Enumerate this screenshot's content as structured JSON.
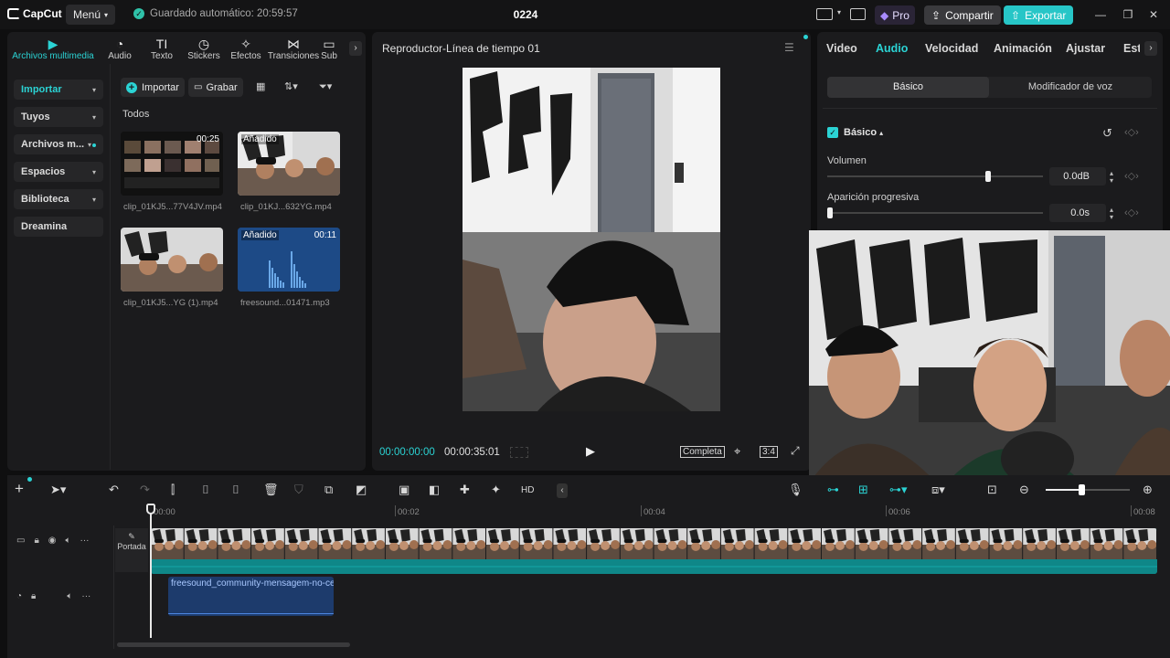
{
  "app": {
    "name": "CapCut",
    "menu_label": "Menú",
    "autosave": "Guardado automático: 20:59:57",
    "project_title": "0224",
    "pro_label": "Pro",
    "share_label": "Compartir",
    "export_label": "Exportar",
    "accent": "#2bd3d4"
  },
  "media": {
    "tabs": [
      {
        "label": "Archivos multimedia",
        "icon": "media-icon"
      },
      {
        "label": "Audio",
        "icon": "audio-icon"
      },
      {
        "label": "Texto",
        "icon": "text-icon"
      },
      {
        "label": "Stickers",
        "icon": "sticker-icon"
      },
      {
        "label": "Efectos",
        "icon": "effects-icon"
      },
      {
        "label": "Transiciones",
        "icon": "transition-icon"
      },
      {
        "label": "Sub",
        "icon": "subtitle-icon"
      }
    ],
    "sidebar": [
      {
        "label": "Importar"
      },
      {
        "label": "Tuyos"
      },
      {
        "label": "Archivos m..."
      },
      {
        "label": "Espacios"
      },
      {
        "label": "Biblioteca"
      },
      {
        "label": "Dreamina"
      }
    ],
    "import_label": "Importar",
    "record_label": "Grabar",
    "section_label": "Todos",
    "items": [
      {
        "name": "clip_01KJ5...77V4JV.mp4",
        "duration": "00:25",
        "tag": ""
      },
      {
        "name": "clip_01KJ...632YG.mp4",
        "duration": "",
        "tag": "Añadido"
      },
      {
        "name": "clip_01KJ5...YG (1).mp4",
        "duration": "",
        "tag": ""
      },
      {
        "name": "freesound...01471.mp3",
        "duration": "00:11",
        "tag": "Añadido"
      }
    ]
  },
  "player": {
    "title": "Reproductor-Línea de tiempo 01",
    "current_time": "00:00:00:00",
    "total_time": "00:00:35:01",
    "full_label": "Completa",
    "ratio_label": "3:4"
  },
  "inspector": {
    "tabs": [
      "Video",
      "Audio",
      "Velocidad",
      "Animación",
      "Ajustar",
      "Est"
    ],
    "active_tab": "Audio",
    "segments": [
      "Básico",
      "Modificador de voz"
    ],
    "section_title": "Básico",
    "volume_label": "Volumen",
    "volume_value": "0.0dB",
    "volume_level": 0.75,
    "fade_label": "Aparición progresiva",
    "fade_value": "0.0s",
    "fade_level": 0.0
  },
  "timeline": {
    "ruler": [
      "00:00",
      "00:02",
      "00:04",
      "00:06",
      "00:08"
    ],
    "cover_label": "Portada",
    "audio_clip_label": "freesound_community-mensagem-no-ce"
  }
}
